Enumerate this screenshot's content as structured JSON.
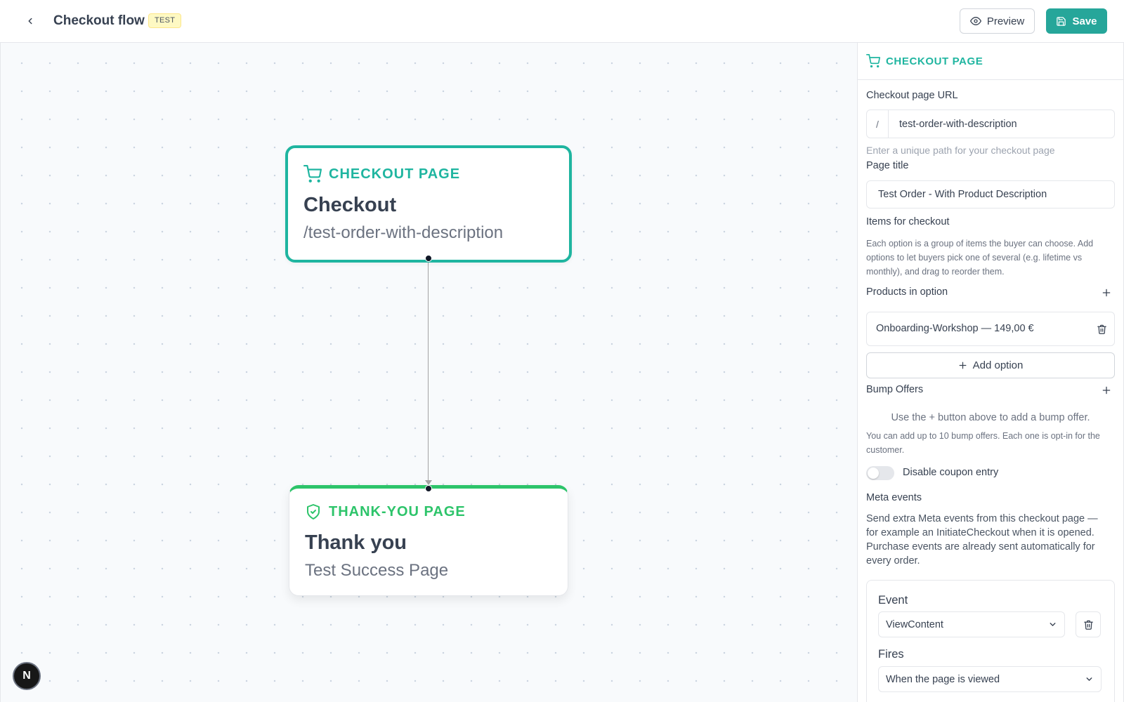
{
  "header": {
    "title": "Checkout flow",
    "badge": "TEST",
    "preview_label": "Preview",
    "save_label": "Save"
  },
  "canvas": {
    "nodes": [
      {
        "type_label": "CHECKOUT PAGE",
        "title": "Checkout",
        "subtitle": "/test-order-with-description"
      },
      {
        "type_label": "THANK-YOU PAGE",
        "title": "Thank you",
        "subtitle": "Test Success Page"
      }
    ],
    "logo_letter": "N"
  },
  "panel": {
    "header": "CHECKOUT PAGE",
    "url_label": "Checkout page URL",
    "url_prefix": "/",
    "url_value": "test-order-with-description",
    "url_hint": "Enter a unique path for your checkout page",
    "page_title_label": "Page title",
    "page_title_value": "Test Order - With Product Description",
    "items_label": "Items for checkout",
    "items_desc": "Each option is a group of items the buyer can choose. Add options to let buyers pick one of several (e.g. lifetime vs monthly), and drag to reorder them.",
    "products_label": "Products in option",
    "product_item": "Onboarding-Workshop — 149,00 €",
    "add_option_label": "Add option",
    "bump_label": "Bump Offers",
    "bump_empty": "Use the + button above to add a bump offer.",
    "bump_desc": "You can add up to 10 bump offers. Each one is opt-in for the customer.",
    "coupon_toggle_label": "Disable coupon entry",
    "coupon_toggle_on": false,
    "meta_label": "Meta events",
    "meta_desc": "Send extra Meta events from this checkout page — for example an InitiateCheckout when it is opened. Purchase events are already sent automatically for every order.",
    "event_label": "Event",
    "event_value": "ViewContent",
    "fires_label": "Fires",
    "fires_value": "When the page is viewed"
  },
  "colors": {
    "accent": "#26a69a",
    "checkout_node": "#1fb5a0",
    "thankyou_node": "#2dc46a",
    "badge_bg": "#fef9c3"
  },
  "icons": {
    "back": "chevron-left-icon",
    "preview": "eye-icon",
    "save": "save-icon",
    "cart": "cart-icon",
    "shield": "shield-check-icon",
    "plus": "plus-icon",
    "trash": "trash-icon",
    "select": "chevron-down-icon"
  }
}
